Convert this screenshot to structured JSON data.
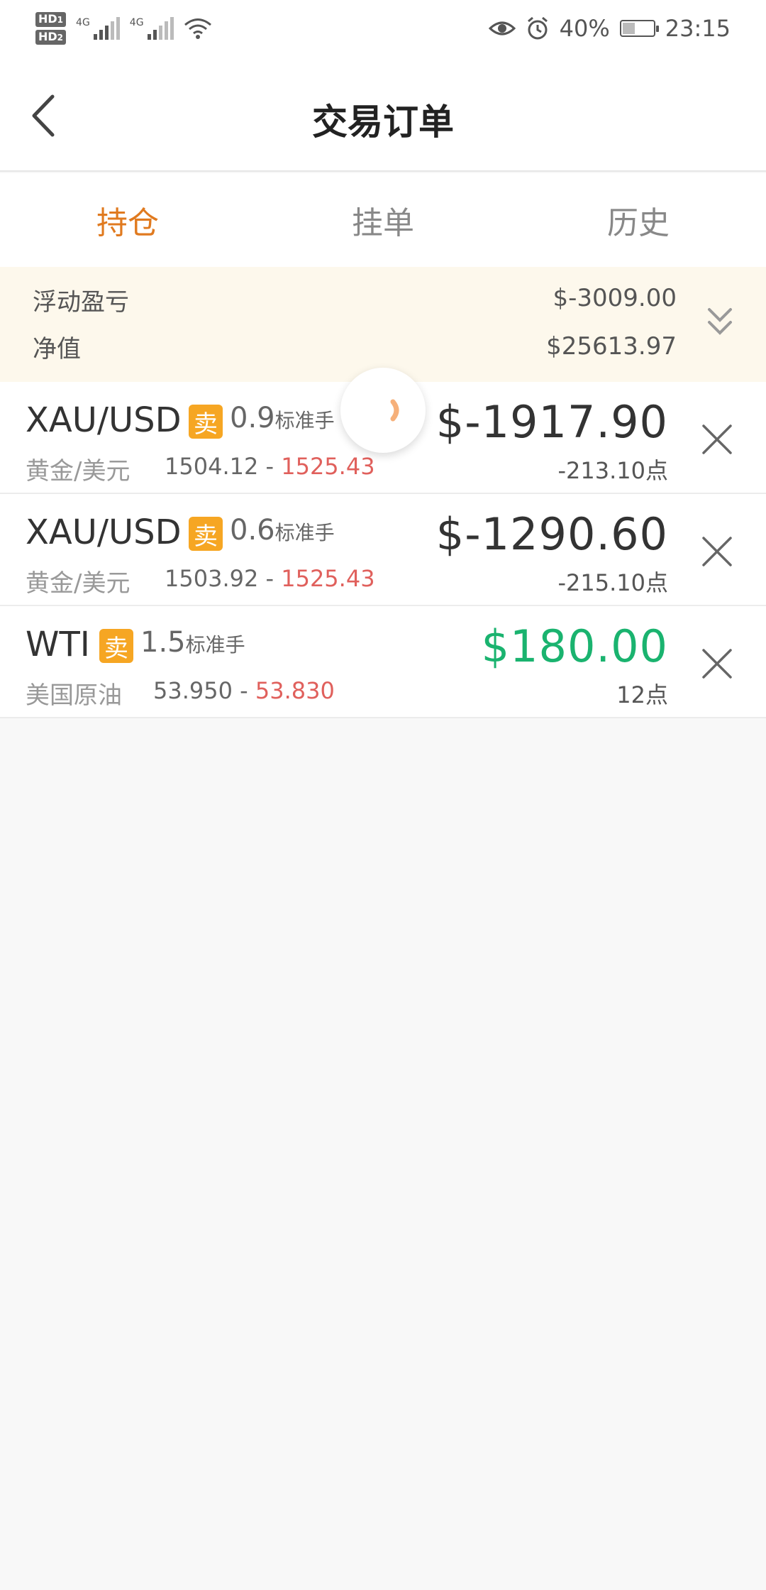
{
  "status_bar": {
    "hd1": "HD",
    "hd1_sub": "1",
    "hd2": "HD",
    "hd2_sub": "2",
    "net1": "4G",
    "net2": "4G",
    "battery_percent": "40%",
    "battery_level": 0.4,
    "time": "23:15"
  },
  "header": {
    "title": "交易订单"
  },
  "tabs": [
    {
      "label": "持仓",
      "active": true
    },
    {
      "label": "挂单",
      "active": false
    },
    {
      "label": "历史",
      "active": false
    }
  ],
  "summary": {
    "floating_pl_label": "浮动盈亏",
    "floating_pl_value": "$-3009.00",
    "equity_label": "净值",
    "equity_value": "$25613.97"
  },
  "orders": [
    {
      "symbol": "XAU/USD",
      "side": "卖",
      "lots": "0.9",
      "unit": "标准手",
      "name": "黄金/美元",
      "open_price": "1504.12",
      "separator": " - ",
      "current_price": "1525.43",
      "pnl": "$-1917.90",
      "points": "-213.10点"
    },
    {
      "symbol": "XAU/USD",
      "side": "卖",
      "lots": "0.6",
      "unit": "标准手",
      "name": "黄金/美元",
      "open_price": "1503.92",
      "separator": " - ",
      "current_price": "1525.43",
      "pnl": "$-1290.60",
      "points": "-215.10点"
    },
    {
      "symbol": "WTI",
      "side": "卖",
      "lots": "1.5",
      "unit": "标准手",
      "name": "美国原油",
      "open_price": "53.950",
      "separator": " - ",
      "current_price": "53.830",
      "pnl": "$180.00",
      "points": "12点"
    }
  ],
  "colors": {
    "accent": "#e07a1f",
    "badge": "#f6a623",
    "loss_price": "#e0605c",
    "profit": "#1ab36f",
    "summary_bg": "#fdf8ec"
  }
}
